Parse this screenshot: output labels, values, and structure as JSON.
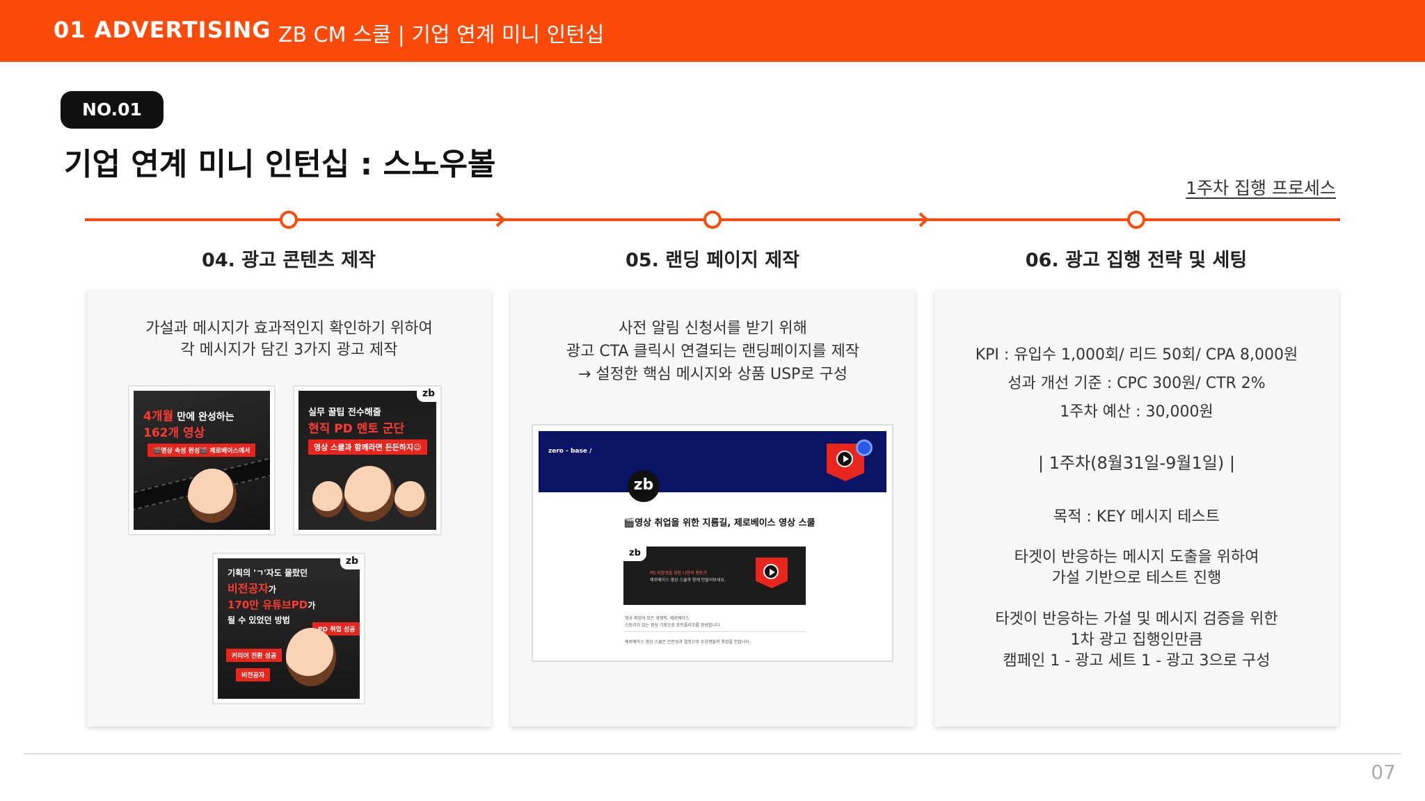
{
  "header": {
    "section": "01  ADVERTISING",
    "subtitle": "ZB CM 스쿨 | 기업 연계 미니 인턴십"
  },
  "badge": "NO.01",
  "title": "기업 연계 미니 인턴십 : 스노우볼",
  "process_link": "1주차 집행 프로세스",
  "colors": {
    "accent": "#fc4a0a",
    "dark": "#111111",
    "card_bg": "#f7f7f7",
    "navy": "#0a1364",
    "red": "#e8261e"
  },
  "steps": [
    {
      "title": "04. 광고 콘텐츠 제작",
      "lines": [
        "가설과 메시지가 효과적인지 확인하기 위하여",
        "각 메시지가 담긴 3가지 광고 제작"
      ],
      "ads": [
        {
          "line1_em": "4개월",
          "line1": "만에 완성하는",
          "line2": "162개 영상",
          "pill": "🎬영상 속성 완성🎬 제로베이스에서"
        },
        {
          "line1": "실무 꿀팁 전수해줄",
          "line2": "현직 PD 멘토 군단",
          "pill": "영상 스쿨과 함께라면 든든하지😉",
          "tag": "zb"
        },
        {
          "line1": "기획의 'ㄱ'자도 몰랐던",
          "line2": "비전공자",
          "line2_suffix": "가",
          "line3": "170만 유튜브PD",
          "line3_suffix": "가",
          "line4": "될 수 있었던 방법",
          "pill1": "PD 취업 성공",
          "pill2": "커리어 전환 성공",
          "pill3": "비전공자",
          "tag": "zb"
        }
      ]
    },
    {
      "title": "05. 랜딩 페이지 제작",
      "lines": [
        "사전 알림 신청서를 받기 위해",
        "광고 CTA 클릭시 연결되는 랜딩페이지를 제작",
        "→ 설정한 핵심 메시지와 상품 USP로 구성"
      ],
      "landing": {
        "brand": "zero - base /",
        "logo": "zb",
        "headline": "🎬영상 취업을 위한 지름길, 제로베이스 영상 스쿨",
        "banner_logo": "zb",
        "banner_text_1": "PD 지망생을 위한 나만의 멘토가",
        "banner_text_2": "제로베이스 영상 스쿨과 함께 만들어보세요.",
        "note_1": "영상 취업의 모든 경쟁력, 제로베이스",
        "note_2": "스토리가 있는 영상 기획으로 포트폴리오를 완성합니다",
        "note_3": "제로베이스 영상 스쿨은 전문성과 열정으로 수강생들의 취업을 만듭니다."
      }
    },
    {
      "title": "06. 광고 집행 전략 및 세팅",
      "kpi": "KPI : 유입수 1,000회/ 리드 50회/ CPA 8,000원",
      "improve": "성과 개선 기준 : CPC 300원/ CTR 2%",
      "budget": "1주차 예산 : 30,000원",
      "period": "| 1주차(8월31일-9월1일) |",
      "purpose": "목적 : KEY 메시지 테스트",
      "p1_1": "타겟이 반응하는 메시지 도출을 위하여",
      "p1_2": "가설 기반으로 테스트 진행",
      "p2_1": "타겟이 반응하는 가설 및 메시지 검증을 위한",
      "p2_2": "1차 광고 집행인만큼",
      "p2_3": "캠페인 1 - 광고 세트 1 - 광고 3으로 구성"
    }
  ],
  "page_number": "07"
}
